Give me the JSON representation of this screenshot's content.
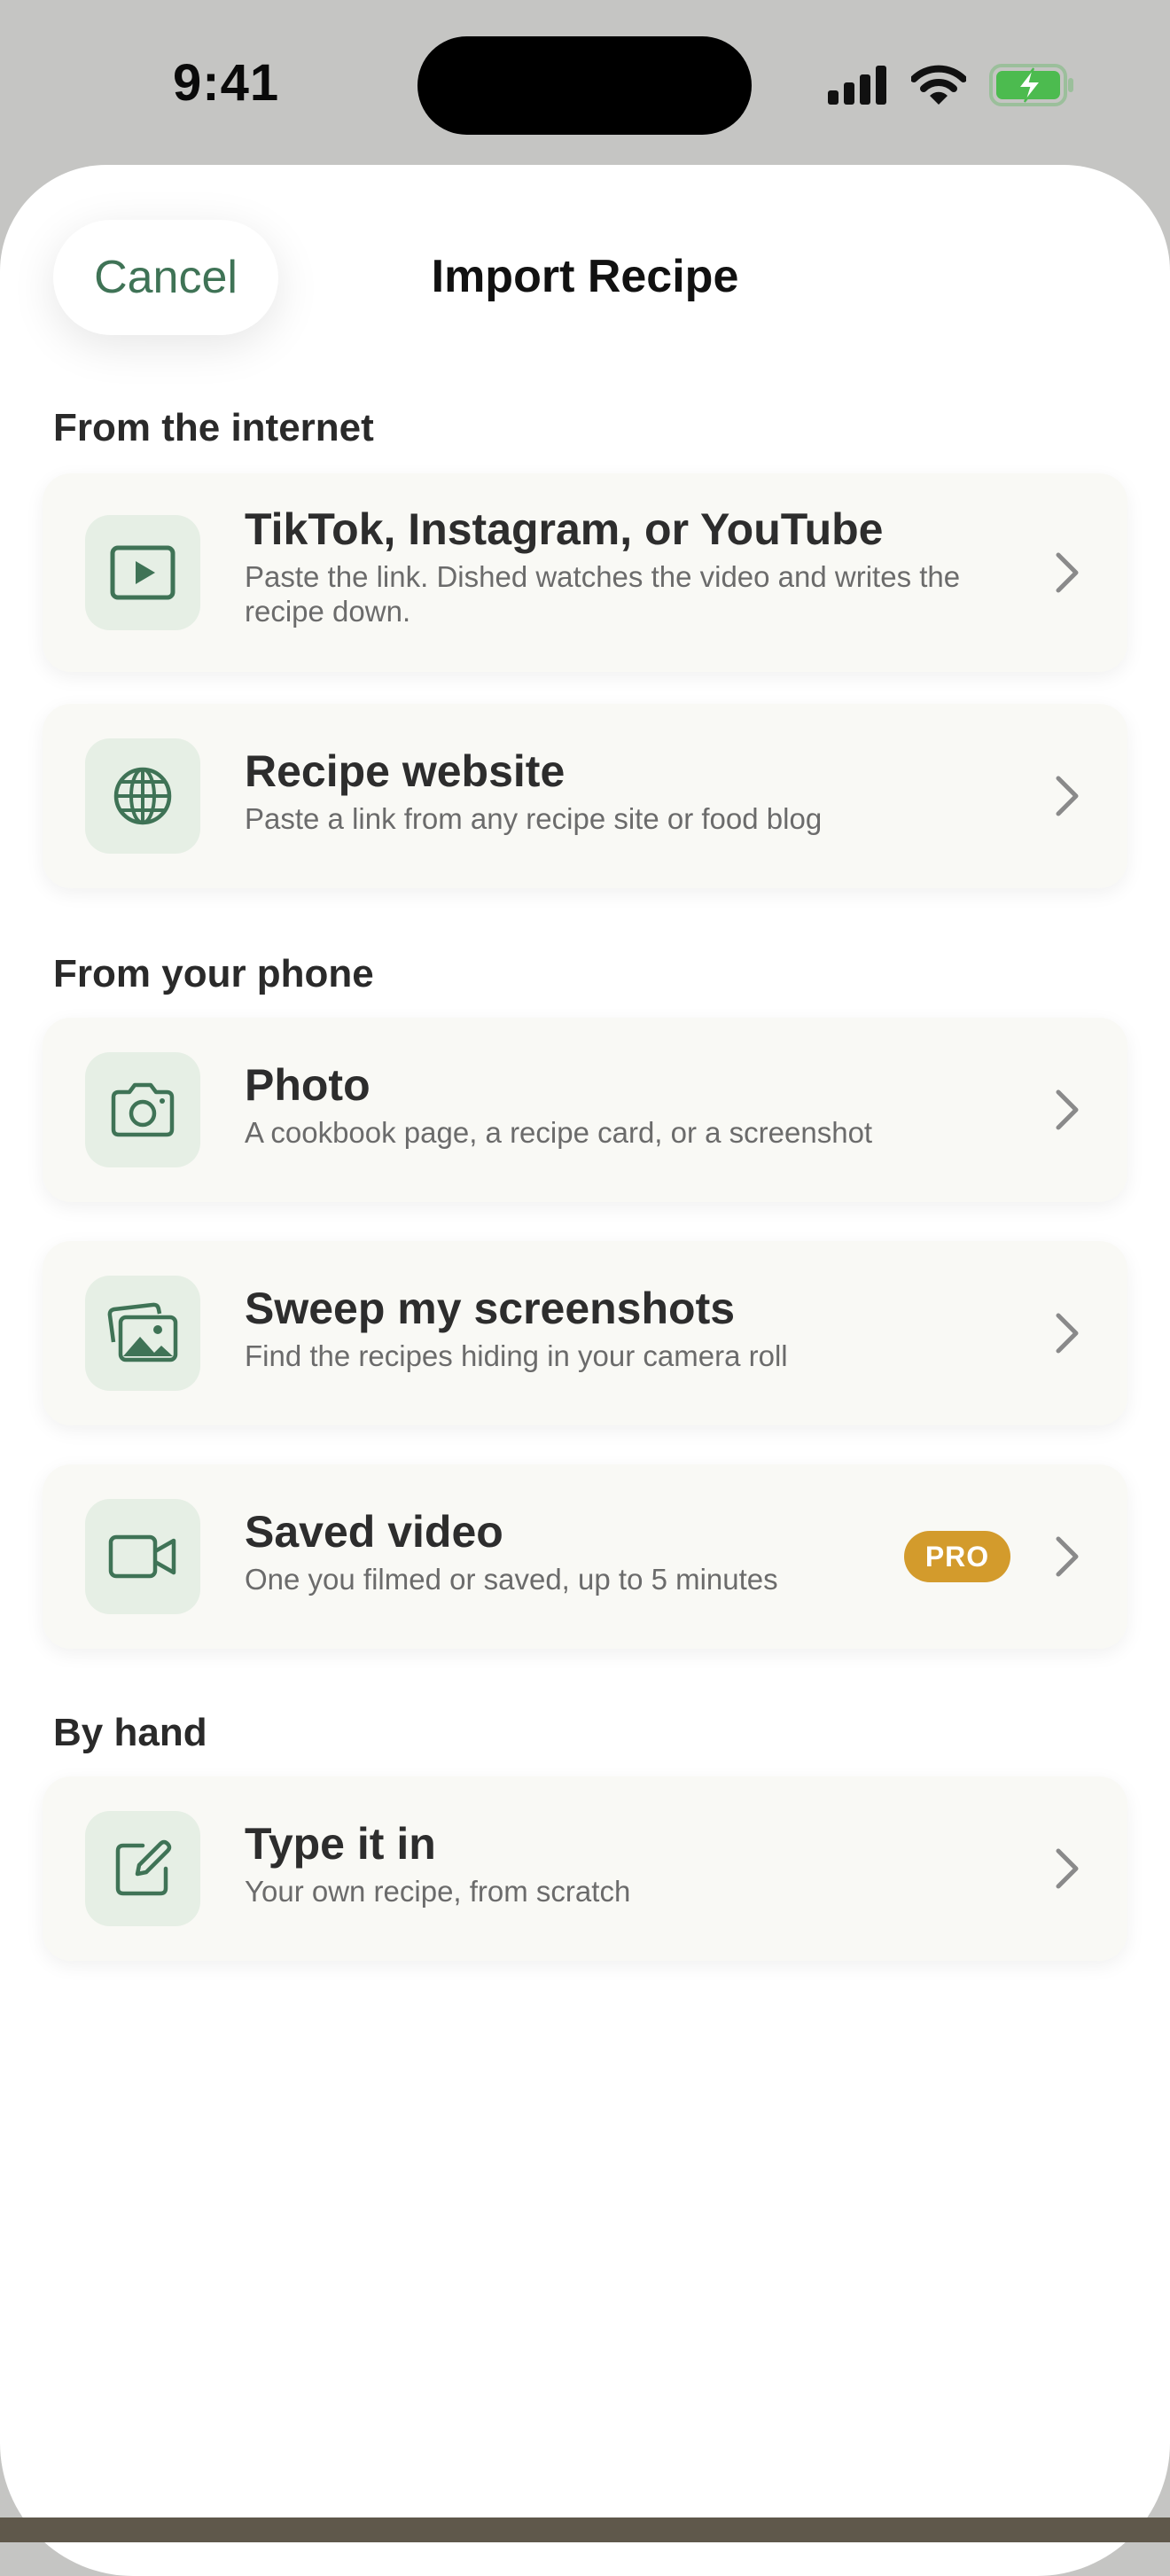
{
  "status_bar": {
    "time": "9:41"
  },
  "sheet": {
    "cancel_label": "Cancel",
    "title": "Import Recipe"
  },
  "sections": [
    {
      "title": "From the internet",
      "items": [
        {
          "title": "TikTok, Instagram, or YouTube",
          "subtitle": "Paste the link. Dished watches the video and writes the recipe down.",
          "icon": "play-video-icon"
        },
        {
          "title": "Recipe website",
          "subtitle": "Paste a link from any recipe site or food blog",
          "icon": "globe-icon"
        }
      ]
    },
    {
      "title": "From your phone",
      "items": [
        {
          "title": "Photo",
          "subtitle": "A cookbook page, a recipe card, or a screenshot",
          "icon": "camera-icon"
        },
        {
          "title": "Sweep my screenshots",
          "subtitle": "Find the recipes hiding in your camera roll",
          "icon": "photo-stack-icon"
        },
        {
          "title": "Saved video",
          "subtitle": "One you filmed or saved, up to 5 minutes",
          "icon": "video-camera-icon",
          "badge": "PRO"
        }
      ]
    },
    {
      "title": "By hand",
      "items": [
        {
          "title": "Type it in",
          "subtitle": "Your own recipe, from scratch",
          "icon": "edit-icon"
        }
      ]
    }
  ],
  "colors": {
    "accent": "#3f7356",
    "icon_tile": "#e6efe5",
    "card_bg": "#f9f9f5",
    "pro_badge": "#d39b2c",
    "battery": "#4cbb4f"
  }
}
